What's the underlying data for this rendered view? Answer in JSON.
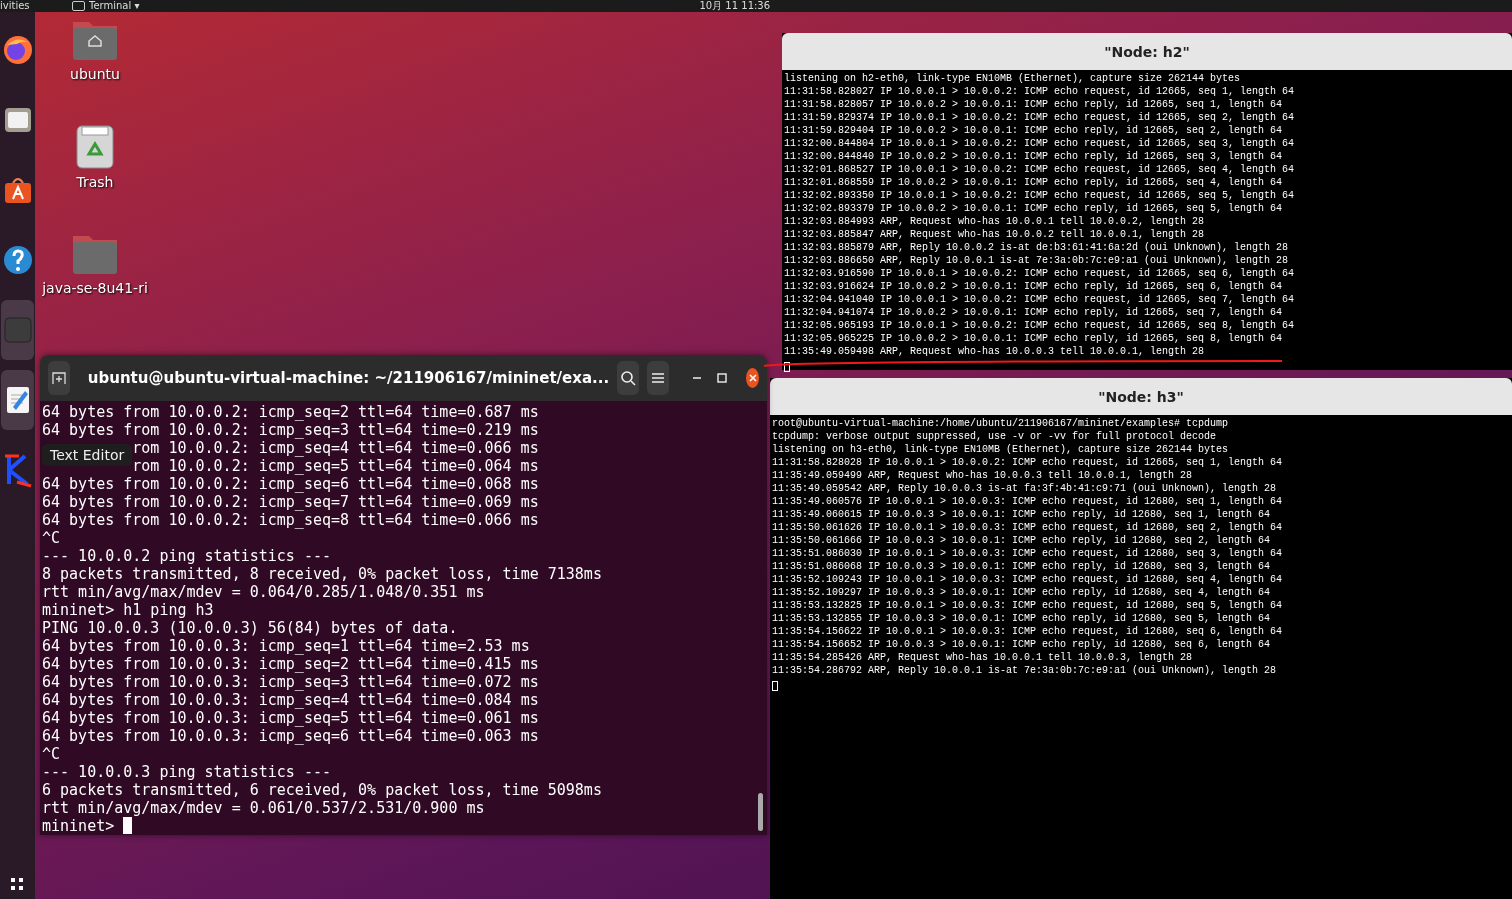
{
  "top_bar": {
    "activities": "ivities",
    "app_menu": "Terminal ▾",
    "clock": "10月 11  11:36"
  },
  "dock": {
    "items": [
      {
        "kind": "firefox",
        "highlighted": false
      },
      {
        "kind": "files",
        "highlighted": false
      },
      {
        "kind": "software",
        "highlighted": false
      },
      {
        "kind": "help",
        "highlighted": false
      },
      {
        "kind": "terminal",
        "highlighted": true
      },
      {
        "kind": "text-editor",
        "highlighted": true
      },
      {
        "kind": "k-app",
        "highlighted": false
      },
      {
        "kind": "app-grid",
        "highlighted": false
      }
    ]
  },
  "tooltip": "Text Editor",
  "desktop_icons": [
    {
      "kind": "home-folder",
      "label": "ubuntu"
    },
    {
      "kind": "trash",
      "label": "Trash"
    },
    {
      "kind": "folder",
      "label": "java-se-8u41-ri"
    }
  ],
  "terminal": {
    "title": "ubuntu@ubuntu-virtual-machine: ~/211906167/mininet/exa...",
    "lines": [
      {
        "text": "64 bytes from 10.0.0.2: icmp_seq=2 ttl=64 time=0.687 ms",
        "covered": false
      },
      {
        "text": "64 bytes from 10.0.0.2: icmp_seq=3 ttl=64 time=0.219 ms",
        "covered": false
      },
      {
        "text": "rom 10.0.0.2: icmp_seq=4 ttl=64 time=0.066 ms",
        "covered": true
      },
      {
        "text": "rom 10.0.0.2: icmp_seq=5 ttl=64 time=0.064 ms",
        "covered": true
      },
      {
        "text": "64 bytes from 10.0.0.2: icmp_seq=6 ttl=64 time=0.068 ms",
        "covered": false
      },
      {
        "text": "64 bytes from 10.0.0.2: icmp_seq=7 ttl=64 time=0.069 ms",
        "covered": false
      },
      {
        "text": "64 bytes from 10.0.0.2: icmp_seq=8 ttl=64 time=0.066 ms",
        "covered": false
      },
      {
        "text": "^C",
        "covered": false
      },
      {
        "text": "--- 10.0.0.2 ping statistics ---",
        "covered": false
      },
      {
        "text": "8 packets transmitted, 8 received, 0% packet loss, time 7138ms",
        "covered": false
      },
      {
        "text": "rtt min/avg/max/mdev = 0.064/0.285/1.048/0.351 ms",
        "covered": false
      },
      {
        "text": "mininet> h1 ping h3",
        "covered": false
      },
      {
        "text": "PING 10.0.0.3 (10.0.0.3) 56(84) bytes of data.",
        "covered": false
      },
      {
        "text": "64 bytes from 10.0.0.3: icmp_seq=1 ttl=64 time=2.53 ms",
        "covered": false
      },
      {
        "text": "64 bytes from 10.0.0.3: icmp_seq=2 ttl=64 time=0.415 ms",
        "covered": false
      },
      {
        "text": "64 bytes from 10.0.0.3: icmp_seq=3 ttl=64 time=0.072 ms",
        "covered": false
      },
      {
        "text": "64 bytes from 10.0.0.3: icmp_seq=4 ttl=64 time=0.084 ms",
        "covered": false
      },
      {
        "text": "64 bytes from 10.0.0.3: icmp_seq=5 ttl=64 time=0.061 ms",
        "covered": false
      },
      {
        "text": "64 bytes from 10.0.0.3: icmp_seq=6 ttl=64 time=0.063 ms",
        "covered": false
      },
      {
        "text": "^C",
        "covered": false
      },
      {
        "text": "--- 10.0.0.3 ping statistics ---",
        "covered": false
      },
      {
        "text": "6 packets transmitted, 6 received, 0% packet loss, time 5098ms",
        "covered": false
      },
      {
        "text": "rtt min/avg/max/mdev = 0.061/0.537/2.531/0.900 ms",
        "covered": false
      },
      {
        "text": "mininet> ",
        "covered": false
      }
    ]
  },
  "node_terminals": [
    {
      "title": "\"Node: h2\"",
      "lines": [
        "listening on h2-eth0, link-type EN10MB (Ethernet), capture size 262144 bytes",
        "11:31:58.828027 IP 10.0.0.1 > 10.0.0.2: ICMP echo request, id 12665, seq 1, length 64",
        "11:31:58.828057 IP 10.0.0.2 > 10.0.0.1: ICMP echo reply, id 12665, seq 1, length 64",
        "11:31:59.829374 IP 10.0.0.1 > 10.0.0.2: ICMP echo request, id 12665, seq 2, length 64",
        "11:31:59.829404 IP 10.0.0.2 > 10.0.0.1: ICMP echo reply, id 12665, seq 2, length 64",
        "11:32:00.844804 IP 10.0.0.1 > 10.0.0.2: ICMP echo request, id 12665, seq 3, length 64",
        "11:32:00.844840 IP 10.0.0.2 > 10.0.0.1: ICMP echo reply, id 12665, seq 3, length 64",
        "11:32:01.868527 IP 10.0.0.1 > 10.0.0.2: ICMP echo request, id 12665, seq 4, length 64",
        "11:32:01.868559 IP 10.0.0.2 > 10.0.0.1: ICMP echo reply, id 12665, seq 4, length 64",
        "11:32:02.893350 IP 10.0.0.1 > 10.0.0.2: ICMP echo request, id 12665, seq 5, length 64",
        "11:32:02.893379 IP 10.0.0.2 > 10.0.0.1: ICMP echo reply, id 12665, seq 5, length 64",
        "11:32:03.884993 ARP, Request who-has 10.0.0.1 tell 10.0.0.2, length 28",
        "11:32:03.885847 ARP, Request who-has 10.0.0.2 tell 10.0.0.1, length 28",
        "11:32:03.885879 ARP, Reply 10.0.0.2 is-at de:b3:61:41:6a:2d (oui Unknown), length 28",
        "11:32:03.886650 ARP, Reply 10.0.0.1 is-at 7e:3a:0b:7c:e9:a1 (oui Unknown), length 28",
        "11:32:03.916590 IP 10.0.0.1 > 10.0.0.2: ICMP echo request, id 12665, seq 6, length 64",
        "11:32:03.916624 IP 10.0.0.2 > 10.0.0.1: ICMP echo reply, id 12665, seq 6, length 64",
        "11:32:04.941040 IP 10.0.0.1 > 10.0.0.2: ICMP echo request, id 12665, seq 7, length 64",
        "11:32:04.941074 IP 10.0.0.2 > 10.0.0.1: ICMP echo reply, id 12665, seq 7, length 64",
        "11:32:05.965193 IP 10.0.0.1 > 10.0.0.2: ICMP echo request, id 12665, seq 8, length 64",
        "11:32:05.965225 IP 10.0.0.2 > 10.0.0.1: ICMP echo reply, id 12665, seq 8, length 64",
        "11:35:49.059498 ARP, Request who-has 10.0.0.3 tell 10.0.0.1, length 28"
      ]
    },
    {
      "title": "\"Node: h3\"",
      "lines": [
        "root@ubuntu-virtual-machine:/home/ubuntu/211906167/mininet/examples# tcpdump",
        "tcpdump: verbose output suppressed, use -v or -vv for full protocol decode",
        "listening on h3-eth0, link-type EN10MB (Ethernet), capture size 262144 bytes",
        "11:31:58.828028 IP 10.0.0.1 > 10.0.0.2: ICMP echo request, id 12665, seq 1, length 64",
        "11:35:49.059499 ARP, Request who-has 10.0.0.3 tell 10.0.0.1, length 28",
        "11:35:49.059542 ARP, Reply 10.0.0.3 is-at fa:3f:4b:41:c9:71 (oui Unknown), length 28",
        "11:35:49.060576 IP 10.0.0.1 > 10.0.0.3: ICMP echo request, id 12680, seq 1, length 64",
        "11:35:49.060615 IP 10.0.0.3 > 10.0.0.1: ICMP echo reply, id 12680, seq 1, length 64",
        "11:35:50.061626 IP 10.0.0.1 > 10.0.0.3: ICMP echo request, id 12680, seq 2, length 64",
        "11:35:50.061666 IP 10.0.0.3 > 10.0.0.1: ICMP echo reply, id 12680, seq 2, length 64",
        "11:35:51.086030 IP 10.0.0.1 > 10.0.0.3: ICMP echo request, id 12680, seq 3, length 64",
        "11:35:51.086068 IP 10.0.0.3 > 10.0.0.1: ICMP echo reply, id 12680, seq 3, length 64",
        "11:35:52.109243 IP 10.0.0.1 > 10.0.0.3: ICMP echo request, id 12680, seq 4, length 64",
        "11:35:52.109297 IP 10.0.0.3 > 10.0.0.1: ICMP echo reply, id 12680, seq 4, length 64",
        "11:35:53.132825 IP 10.0.0.1 > 10.0.0.3: ICMP echo request, id 12680, seq 5, length 64",
        "11:35:53.132855 IP 10.0.0.3 > 10.0.0.1: ICMP echo reply, id 12680, seq 5, length 64",
        "11:35:54.156622 IP 10.0.0.1 > 10.0.0.3: ICMP echo request, id 12680, seq 6, length 64",
        "11:35:54.156652 IP 10.0.0.3 > 10.0.0.1: ICMP echo reply, id 12680, seq 6, length 64",
        "11:35:54.285426 ARP, Request who-has 10.0.0.1 tell 10.0.0.3, length 28",
        "11:35:54.286792 ARP, Reply 10.0.0.1 is-at 7e:3a:0b:7c:e9:a1 (oui Unknown), length 28"
      ]
    }
  ]
}
